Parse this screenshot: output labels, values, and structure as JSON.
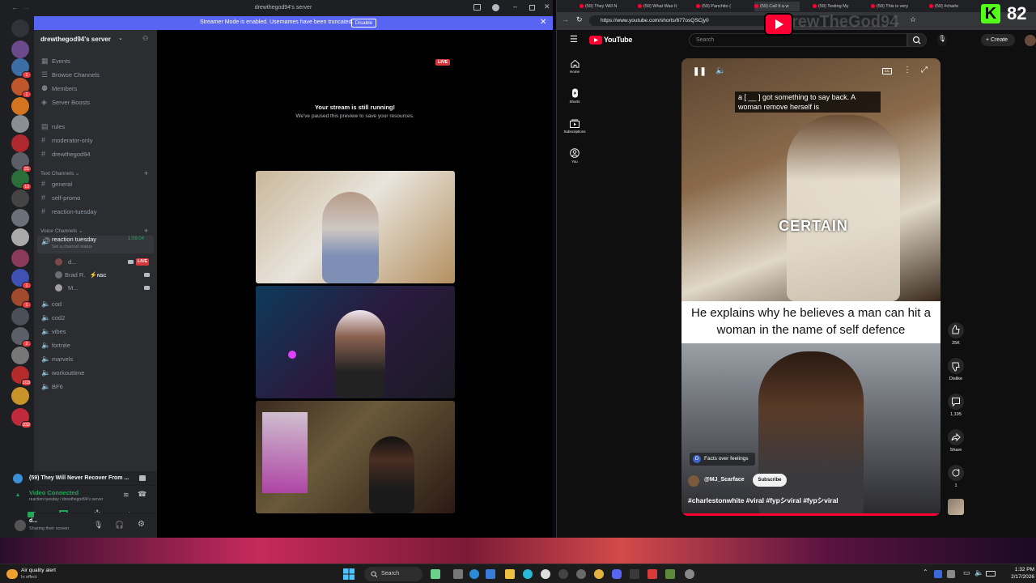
{
  "discord": {
    "window_title": "drewthegod94's server",
    "banner": {
      "text": "Streamer Mode is enabled. Usernames have been truncated.",
      "button": "Disable"
    },
    "server_name": "drewthegod94's server",
    "menu": [
      "Events",
      "Browse Channels",
      "Members",
      "Server Boosts"
    ],
    "text_top": [
      "rules",
      "moderator-only",
      "drewthegod94"
    ],
    "text_category": "Text Channels",
    "text_channels": [
      "general",
      "self-promo",
      "reaction-tuesday"
    ],
    "voice_category": "Voice Channels",
    "active_voice": {
      "name": "reaction tuesday",
      "status": "Set a channel status",
      "timer": "1:09:04"
    },
    "voice_users": [
      {
        "name": "d...",
        "badge": "LIVE"
      },
      {
        "name": "Brad R.",
        "tag": "NSC"
      },
      {
        "name": "M..."
      }
    ],
    "other_voice": [
      "cod",
      "cod2",
      "vibes",
      "fortnite",
      "marvels",
      "workouttime",
      "BF6"
    ],
    "server_badges": [
      "1",
      "1",
      "21",
      "10",
      "1",
      "1",
      "2",
      "103",
      "232"
    ],
    "activity": "(59) They Will Never Recover From ...",
    "connection": {
      "title": "Video Connected",
      "subtitle": "reaction tuesday / drewthegod94's server"
    },
    "user": {
      "name": "d...",
      "status": "Sharing their screen"
    },
    "stream_notice": {
      "title": "Your stream is still running!",
      "subtitle": "We've paused this preview to save your resources.",
      "live": "LIVE"
    }
  },
  "browser": {
    "tabs": [
      "(59) They Will N",
      "(59) What Was It",
      "(59) Panchito (",
      "(59) Call It a w",
      "(59) Testing My",
      "(59) This is very",
      "(59) #charle"
    ],
    "url": "https://www.youtube.com/shorts/677osQSCjy0"
  },
  "youtube": {
    "logo_text": "YouTube",
    "search_placeholder": "Search",
    "create_label": "Create",
    "rail": [
      "Home",
      "Shorts",
      "Subscriptions",
      "You"
    ],
    "short": {
      "caption_top": "a [ __ ] got something to say back. A woman remove herself is",
      "overlay_word": "CERTAIN",
      "headline": "He explains why he believes a man can hit a woman in the name of self defence",
      "channel_tag_letter": "D",
      "channel_tag": "Facts over feelings",
      "handle": "@MJ_Scarface",
      "subscribe": "Subscribe",
      "hashtags": "#charlestonwhite #viral #fypシviral #fypシviral"
    },
    "actions": [
      {
        "name": "like",
        "label": "25K"
      },
      {
        "name": "dislike",
        "label": "Dislike"
      },
      {
        "name": "comments",
        "label": "1,195"
      },
      {
        "name": "share",
        "label": "Share"
      },
      {
        "name": "remix",
        "label": "1"
      }
    ]
  },
  "overlay": {
    "channel_watermark": "rewTheGod94",
    "k_score": "82"
  },
  "taskbar": {
    "weather_title": "Air quality alert",
    "weather_sub": "In effect",
    "search": "Search",
    "time": "1:32 PM",
    "date": "2/17/2026"
  }
}
